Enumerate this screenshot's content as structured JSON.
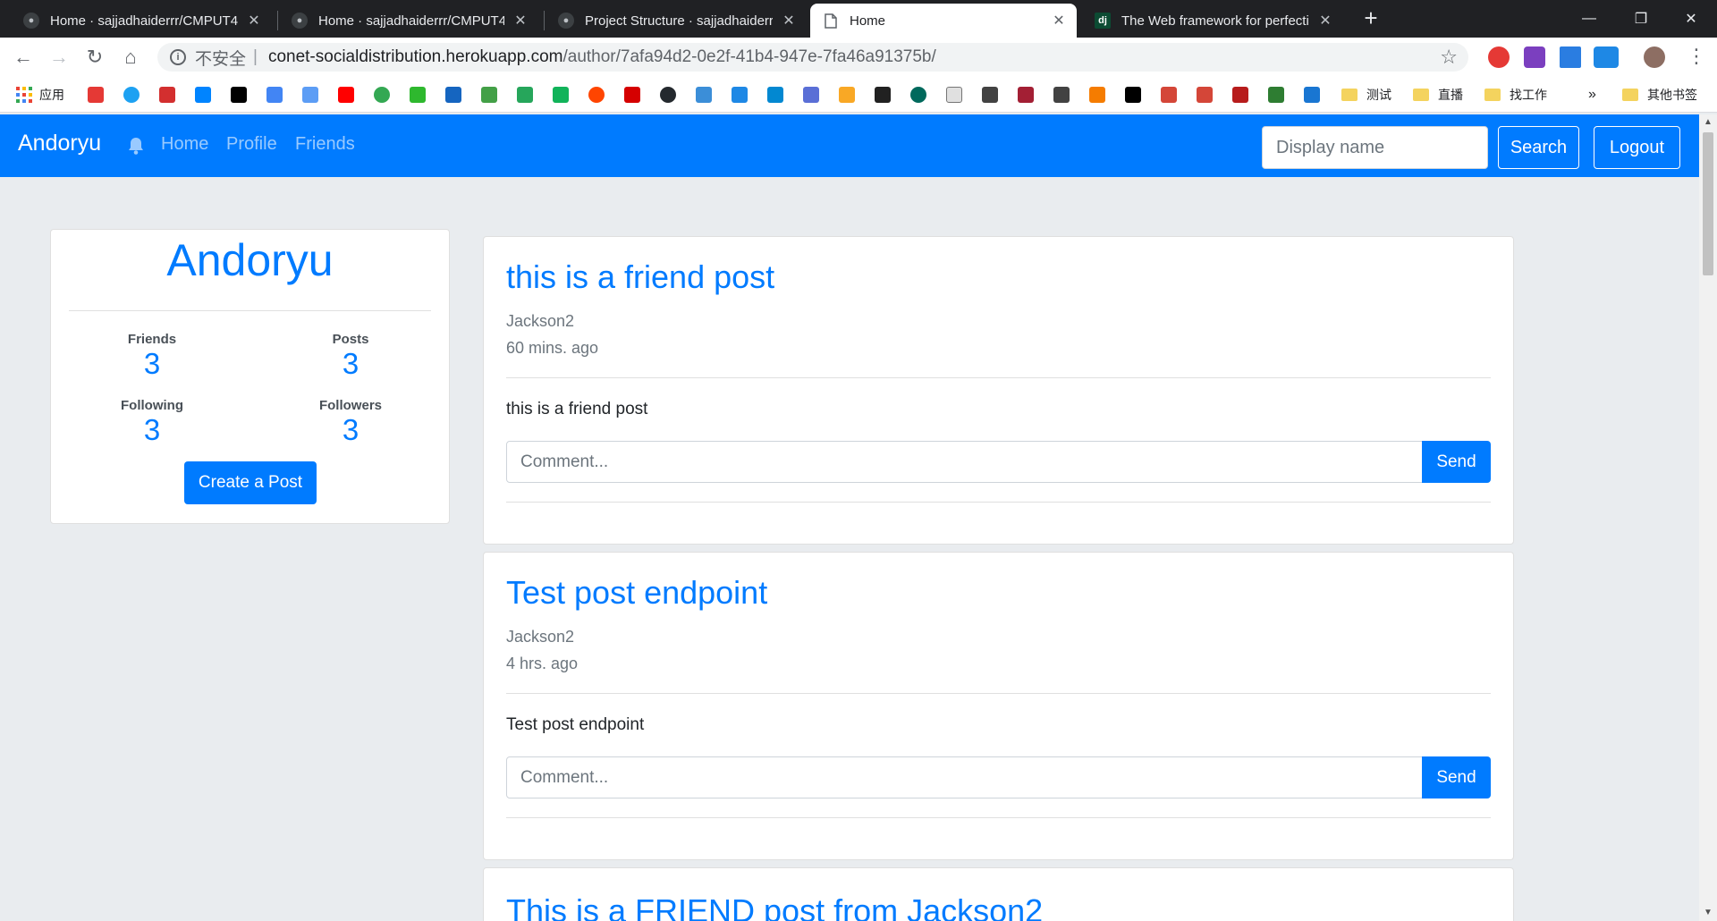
{
  "browser": {
    "tabs": [
      {
        "title": "Home · sajjadhaiderrr/CMPUT404",
        "active": false,
        "icon": "github-icon"
      },
      {
        "title": "Home · sajjadhaiderrr/CMPUT404",
        "active": false,
        "icon": "github-icon"
      },
      {
        "title": "Project Structure · sajjadhaiderrr",
        "active": false,
        "icon": "github-icon"
      },
      {
        "title": "Home",
        "active": true,
        "icon": "document-icon"
      },
      {
        "title": "The Web framework for perfectionists",
        "active": false,
        "icon": "django-icon",
        "icon_text": "dj"
      }
    ],
    "address": {
      "security_label": "不安全",
      "separator": "|",
      "domain": "conet-socialdistribution.herokuapp.com",
      "path": "/author/7afa94d2-0e2f-41b4-947e-7fa46a91375b/"
    },
    "bookmarks": {
      "apps_label": "应用",
      "folders": [
        "测试",
        "直播",
        "找工作"
      ],
      "overflow": "»",
      "other_label": "其他书签"
    }
  },
  "navbar": {
    "brand": "Andoryu",
    "links": [
      "Home",
      "Profile",
      "Friends"
    ],
    "search_placeholder": "Display name",
    "search_button": "Search",
    "logout_button": "Logout"
  },
  "profile": {
    "name": "Andoryu",
    "stats": {
      "friends_label": "Friends",
      "friends": "3",
      "posts_label": "Posts",
      "posts": "3",
      "following_label": "Following",
      "following": "3",
      "followers_label": "Followers",
      "followers": "3"
    },
    "create_post_button": "Create a Post"
  },
  "posts": [
    {
      "title": "this is a friend post",
      "author": "Jackson2",
      "time": "60 mins. ago",
      "body": "this is a friend post",
      "comment_placeholder": "Comment...",
      "send_label": "Send"
    },
    {
      "title": "Test post endpoint",
      "author": "Jackson2",
      "time": "4 hrs. ago",
      "body": "Test post endpoint",
      "comment_placeholder": "Comment...",
      "send_label": "Send"
    },
    {
      "title": "This is a FRIEND post from Jackson2"
    }
  ],
  "colors": {
    "primary": "#007bff",
    "page_bg": "#e9ecef",
    "tab_strip": "#202124"
  }
}
